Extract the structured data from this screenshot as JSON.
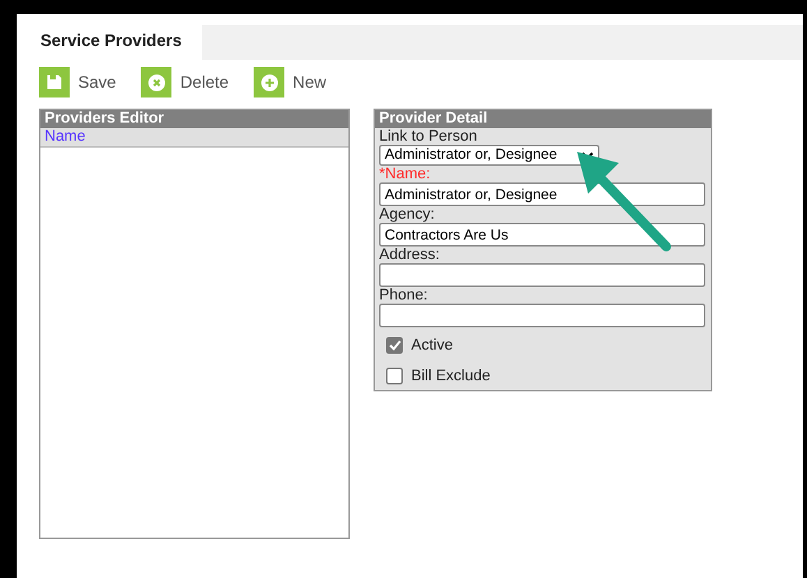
{
  "tabs": [
    {
      "label": "Service Providers",
      "selected": true
    }
  ],
  "toolbar": [
    {
      "kind": "save",
      "label": "Save"
    },
    {
      "kind": "delete",
      "label": "Delete"
    },
    {
      "kind": "new",
      "label": "New"
    }
  ],
  "providers_editor": {
    "title": "Providers Editor",
    "columns": [
      "Name"
    ]
  },
  "provider_detail": {
    "title": "Provider Detail",
    "fields": [
      {
        "kind": "select",
        "label": "Link to Person",
        "value": "Administrator or, Designee",
        "required": false
      },
      {
        "kind": "text",
        "label": "*Name:",
        "value": "Administrator or, Designee",
        "required": true
      },
      {
        "kind": "text",
        "label": "Agency:",
        "value": "Contractors Are Us",
        "required": false
      },
      {
        "kind": "text",
        "label": "Address:",
        "required": false
      },
      {
        "kind": "text",
        "label": "Phone:",
        "required": false
      }
    ],
    "checkboxes": [
      {
        "label": "Active",
        "checked": true
      },
      {
        "label": "Bill Exclude",
        "checked": false
      }
    ]
  }
}
